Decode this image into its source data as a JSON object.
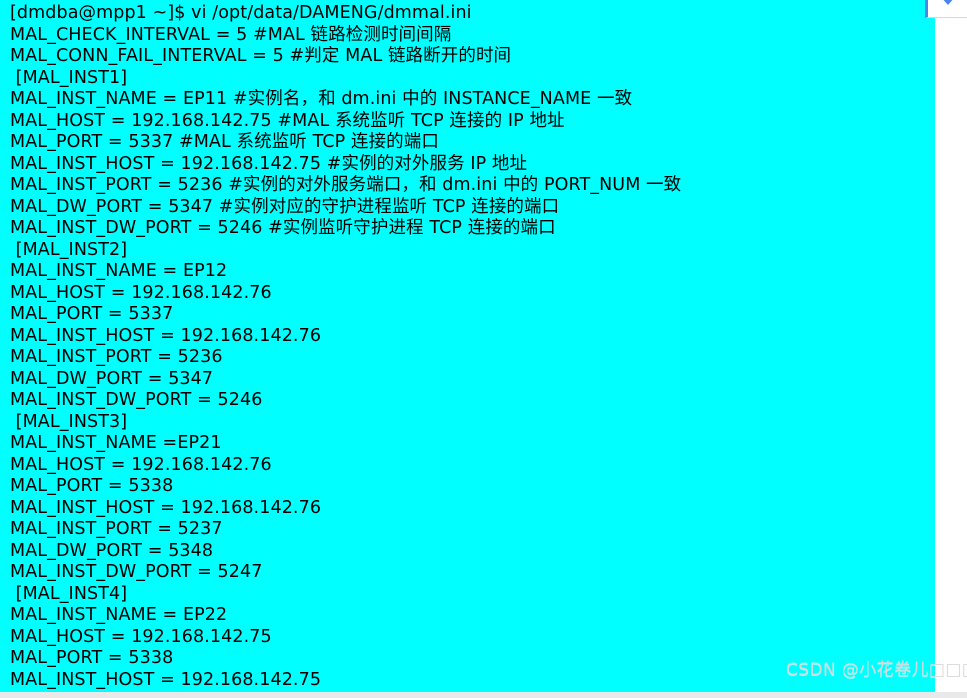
{
  "window": {
    "background_color": "#00ffff",
    "text_color": "#000000",
    "outside_color": "#ffffff"
  },
  "corner_widget": {
    "icon": "chevron-down-icon",
    "accent_color": "#4a86e8"
  },
  "watermark": {
    "prefix": "CSDN @",
    "author": "小花卷儿",
    "boxes": "□□□□",
    "full": "CSDN @小花卷儿□□□□",
    "color": "#d8d8d8"
  },
  "terminal": {
    "prompt_line": "[dmdba@mpp1 ~]$ vi /opt/data/DAMENG/dmmal.ini",
    "file_path": "/opt/data/DAMENG/dmmal.ini",
    "editor": "vi",
    "user": "dmdba",
    "host": "mpp1",
    "cwd": "~",
    "lines": [
      "[dmdba@mpp1 ~]$ vi /opt/data/DAMENG/dmmal.ini",
      "MAL_CHECK_INTERVAL = 5 #MAL 链路检测时间间隔",
      "MAL_CONN_FAIL_INTERVAL = 5 #判定 MAL 链路断开的时间",
      " [MAL_INST1]",
      "MAL_INST_NAME = EP11 #实例名，和 dm.ini 中的 INSTANCE_NAME 一致",
      "MAL_HOST = 192.168.142.75 #MAL 系统监听 TCP 连接的 IP 地址",
      "MAL_PORT = 5337 #MAL 系统监听 TCP 连接的端口",
      "MAL_INST_HOST = 192.168.142.75 #实例的对外服务 IP 地址",
      "MAL_INST_PORT = 5236 #实例的对外服务端口，和 dm.ini 中的 PORT_NUM 一致",
      "MAL_DW_PORT = 5347 #实例对应的守护进程监听 TCP 连接的端口",
      "MAL_INST_DW_PORT = 5246 #实例监听守护进程 TCP 连接的端口",
      " [MAL_INST2]",
      "MAL_INST_NAME = EP12",
      "MAL_HOST = 192.168.142.76",
      "MAL_PORT = 5337",
      "MAL_INST_HOST = 192.168.142.76",
      "MAL_INST_PORT = 5236",
      "MAL_DW_PORT = 5347",
      "MAL_INST_DW_PORT = 5246",
      " [MAL_INST3]",
      "MAL_INST_NAME =EP21",
      "MAL_HOST = 192.168.142.76",
      "MAL_PORT = 5338",
      "MAL_INST_HOST = 192.168.142.76",
      "MAL_INST_PORT = 5237",
      "MAL_DW_PORT = 5348",
      "MAL_INST_DW_PORT = 5247",
      " [MAL_INST4]",
      "MAL_INST_NAME = EP22",
      "MAL_HOST = 192.168.142.75",
      "MAL_PORT = 5338",
      "MAL_INST_HOST = 192.168.142.75"
    ]
  }
}
